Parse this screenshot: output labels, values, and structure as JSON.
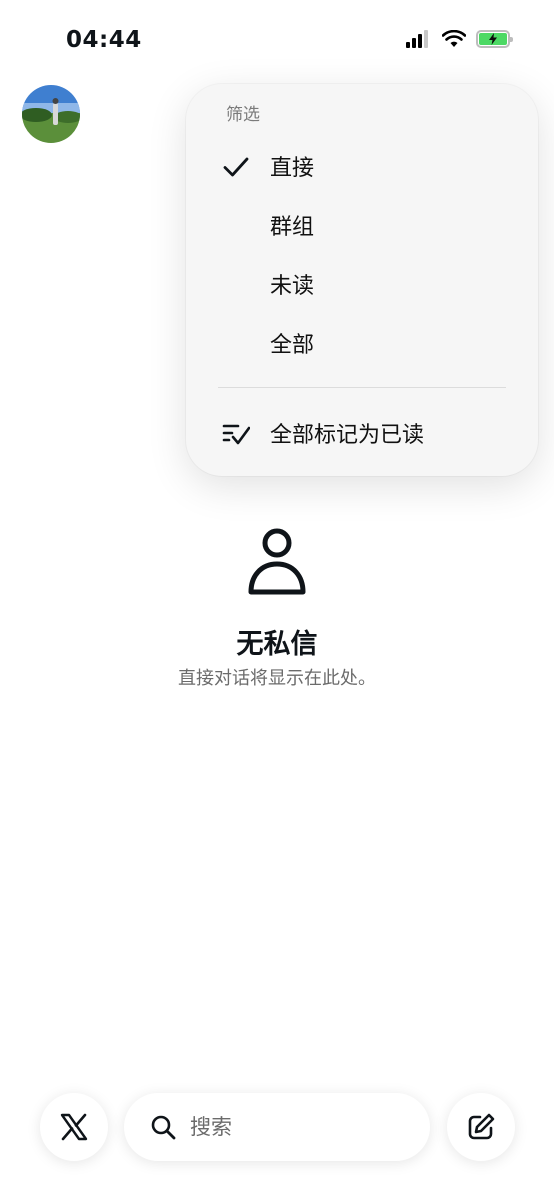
{
  "status_bar": {
    "time": "04:44",
    "signal_icon": "cellular-signal-icon",
    "wifi_icon": "wifi-icon",
    "battery_icon": "battery-charging-icon",
    "battery_color": "#4cd964"
  },
  "header": {
    "avatar_icon": "profile-avatar"
  },
  "filter_menu": {
    "header": "筛选",
    "items": [
      {
        "label": "直接",
        "selected": true,
        "icon": "checkmark-icon"
      },
      {
        "label": "群组",
        "selected": false
      },
      {
        "label": "未读",
        "selected": false
      },
      {
        "label": "全部",
        "selected": false
      }
    ],
    "mark_all_read": {
      "label": "全部标记为已读",
      "icon": "mark-read-icon"
    }
  },
  "empty_state": {
    "icon": "person-icon",
    "title": "无私信",
    "subtitle": "直接对话将显示在此处。"
  },
  "bottom_bar": {
    "home_icon": "x-logo-icon",
    "search_icon": "search-icon",
    "search_placeholder": "搜索",
    "compose_icon": "compose-icon"
  }
}
